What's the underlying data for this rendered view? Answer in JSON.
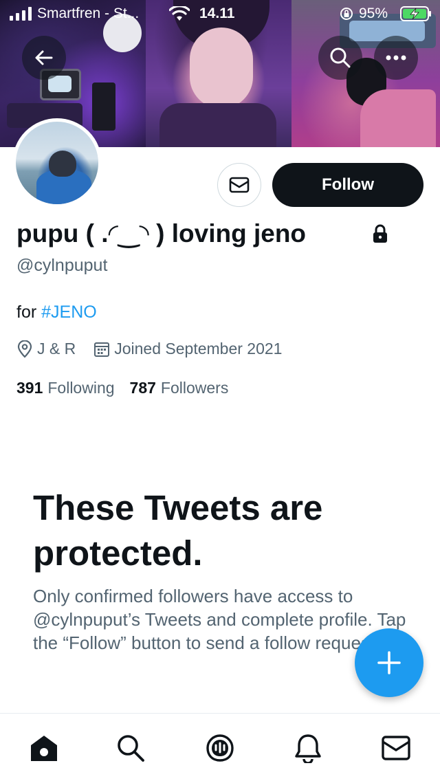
{
  "status_bar": {
    "carrier": "Smartfren - St...",
    "time": "14.11",
    "battery": "95%"
  },
  "profile": {
    "display_name": "pupu ( .◜‿◝ ) loving jeno",
    "handle": "@cylnpuput",
    "bio_prefix": "for ",
    "bio_hashtag": "#JENO",
    "location": "J & R",
    "joined": "Joined September 2021",
    "following_count": "391",
    "following_label": "Following",
    "followers_count": "787",
    "followers_label": "Followers"
  },
  "actions": {
    "follow_label": "Follow"
  },
  "protected": {
    "title": "These Tweets are protected.",
    "body": "Only confirmed followers have access to @cylnpuput’s Tweets and complete profile. Tap the “Follow” button to send a follow request."
  },
  "icons": {
    "back": "back-arrow-icon",
    "search": "search-icon",
    "more": "more-icon",
    "message": "envelope-icon",
    "lock": "lock-icon",
    "location": "location-icon",
    "calendar": "calendar-icon",
    "compose": "plus-icon",
    "nav": [
      "home-icon",
      "search-icon",
      "spaces-icon",
      "notifications-icon",
      "messages-icon"
    ]
  },
  "colors": {
    "accent": "#1d9bf0",
    "primary_text": "#0f1419",
    "secondary_text": "#536471",
    "follow_button": "#0f1419"
  }
}
